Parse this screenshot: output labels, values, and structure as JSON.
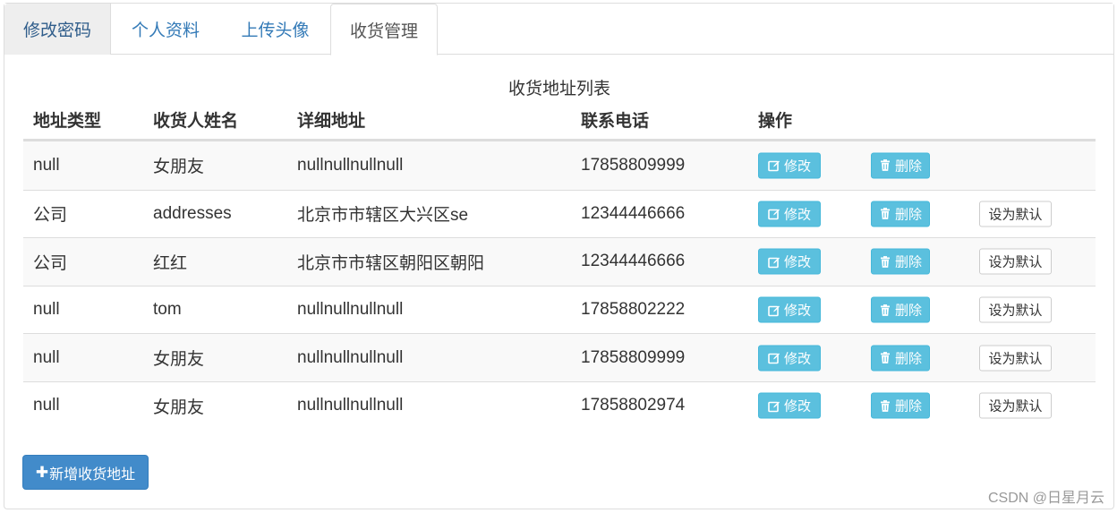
{
  "tabs": [
    {
      "label": "修改密码"
    },
    {
      "label": "个人资料"
    },
    {
      "label": "上传头像"
    },
    {
      "label": "收货管理"
    }
  ],
  "caption": "收货地址列表",
  "columns": [
    "地址类型",
    "收货人姓名",
    "详细地址",
    "联系电话",
    "操作"
  ],
  "rows": [
    {
      "type": "null",
      "name": "女朋友",
      "address": "nullnullnullnull",
      "phone": "17858809999",
      "edit": "修改",
      "delete": "删除",
      "default": ""
    },
    {
      "type": "公司",
      "name": "addresses",
      "address": "北京市市辖区大兴区se",
      "phone": "12344446666",
      "edit": "修改",
      "delete": "删除",
      "default": "设为默认"
    },
    {
      "type": "公司",
      "name": "红红",
      "address": "北京市市辖区朝阳区朝阳",
      "phone": "12344446666",
      "edit": "修改",
      "delete": "删除",
      "default": "设为默认"
    },
    {
      "type": "null",
      "name": "tom",
      "address": "nullnullnullnull",
      "phone": "17858802222",
      "edit": "修改",
      "delete": "删除",
      "default": "设为默认"
    },
    {
      "type": "null",
      "name": "女朋友",
      "address": "nullnullnullnull",
      "phone": "17858809999",
      "edit": "修改",
      "delete": "删除",
      "default": "设为默认"
    },
    {
      "type": "null",
      "name": "女朋友",
      "address": "nullnullnullnull",
      "phone": "17858802974",
      "edit": "修改",
      "delete": "删除",
      "default": "设为默认"
    }
  ],
  "add_button": {
    "icon": "plus-icon",
    "label": "新增收货地址"
  },
  "watermark": "CSDN @日星月云",
  "colors": {
    "info": "#5bc0de",
    "primary": "#428bca",
    "link": "#337ab7"
  }
}
